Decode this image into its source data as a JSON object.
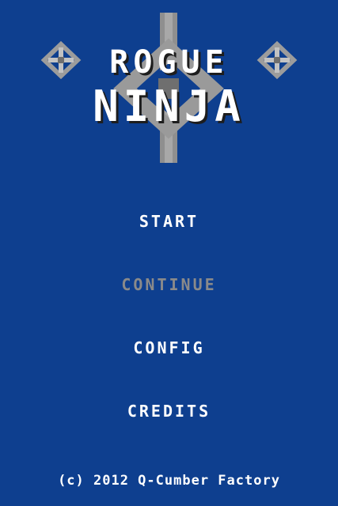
{
  "title": {
    "line1": "ROGUE",
    "line2": "NINJA"
  },
  "menu": {
    "items": [
      {
        "label": "START",
        "enabled": true
      },
      {
        "label": "CONTINUE",
        "enabled": false
      },
      {
        "label": "CONFIG",
        "enabled": true
      },
      {
        "label": "CREDITS",
        "enabled": true
      }
    ]
  },
  "footer": {
    "copyright": "(c) 2012 Q-Cumber Factory"
  },
  "colors": {
    "background": "#0e3f8f",
    "text": "#ffffff",
    "disabled_text": "#8a8a8a",
    "shuriken_light": "#a3a3a3",
    "shuriken_dark": "#6f6f6f"
  }
}
